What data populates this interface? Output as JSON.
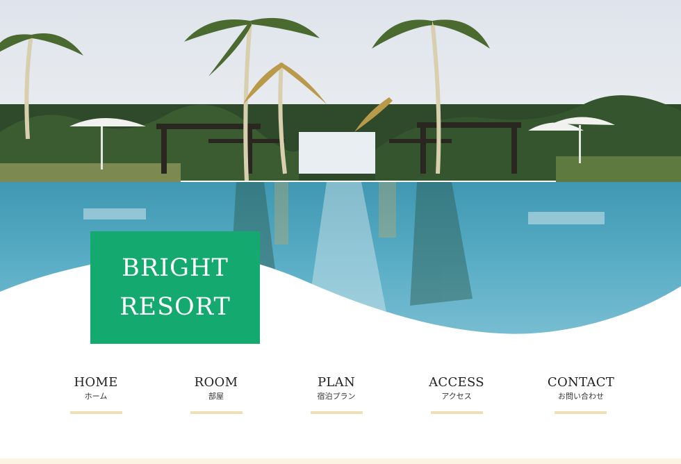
{
  "hero": {
    "image": "resort-pool-with-palm-trees-photo"
  },
  "logo": {
    "line1": "BRIGHT",
    "line2": "RESORT",
    "bg_color": "#14a96e"
  },
  "nav": {
    "items": [
      {
        "en": "HOME",
        "ja": "ホーム"
      },
      {
        "en": "ROOM",
        "ja": "部屋"
      },
      {
        "en": "PLAN",
        "ja": "宿泊プラン"
      },
      {
        "en": "ACCESS",
        "ja": "アクセス"
      },
      {
        "en": "CONTACT",
        "ja": "お問い合わせ"
      }
    ],
    "underline_color": "#ede0b9"
  },
  "colors": {
    "accent": "#14a96e",
    "footer": "#fbf4e2"
  }
}
